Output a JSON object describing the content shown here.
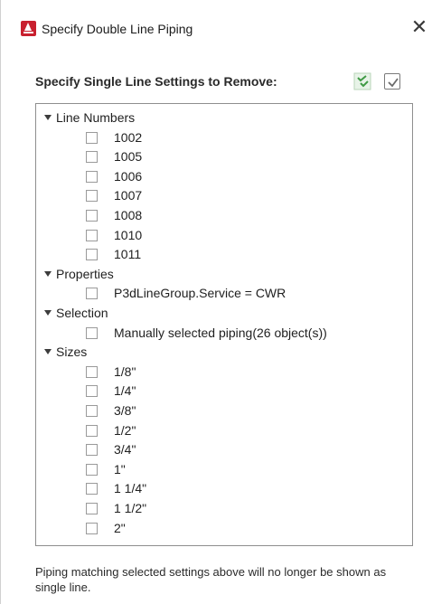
{
  "dialog": {
    "title": "Specify Double Line Piping",
    "close_glyph": "✕"
  },
  "header": {
    "label": "Specify Single Line Settings to Remove:",
    "select_all_icon": "select-all-icon",
    "check-all_icon": "check-all-icon"
  },
  "tree": {
    "groups": [
      {
        "label": "Line Numbers",
        "items": [
          "1002",
          "1005",
          "1006",
          "1007",
          "1008",
          "1010",
          "1011"
        ]
      },
      {
        "label": "Properties",
        "items": [
          "P3dLineGroup.Service = CWR"
        ]
      },
      {
        "label": "Selection",
        "items": [
          "Manually selected piping(26 object(s))"
        ]
      },
      {
        "label": "Sizes",
        "items": [
          "1/8\"",
          "1/4\"",
          "3/8\"",
          "1/2\"",
          "3/4\"",
          "1\"",
          "1 1/4\"",
          "1 1/2\"",
          "2\""
        ]
      }
    ]
  },
  "footer": {
    "text": "Piping matching selected settings above will no longer be shown as single line."
  },
  "colors": {
    "app_icon": "#c8202f",
    "select_all_icon_green": "#4caf50",
    "border": "#8e8e8e"
  }
}
